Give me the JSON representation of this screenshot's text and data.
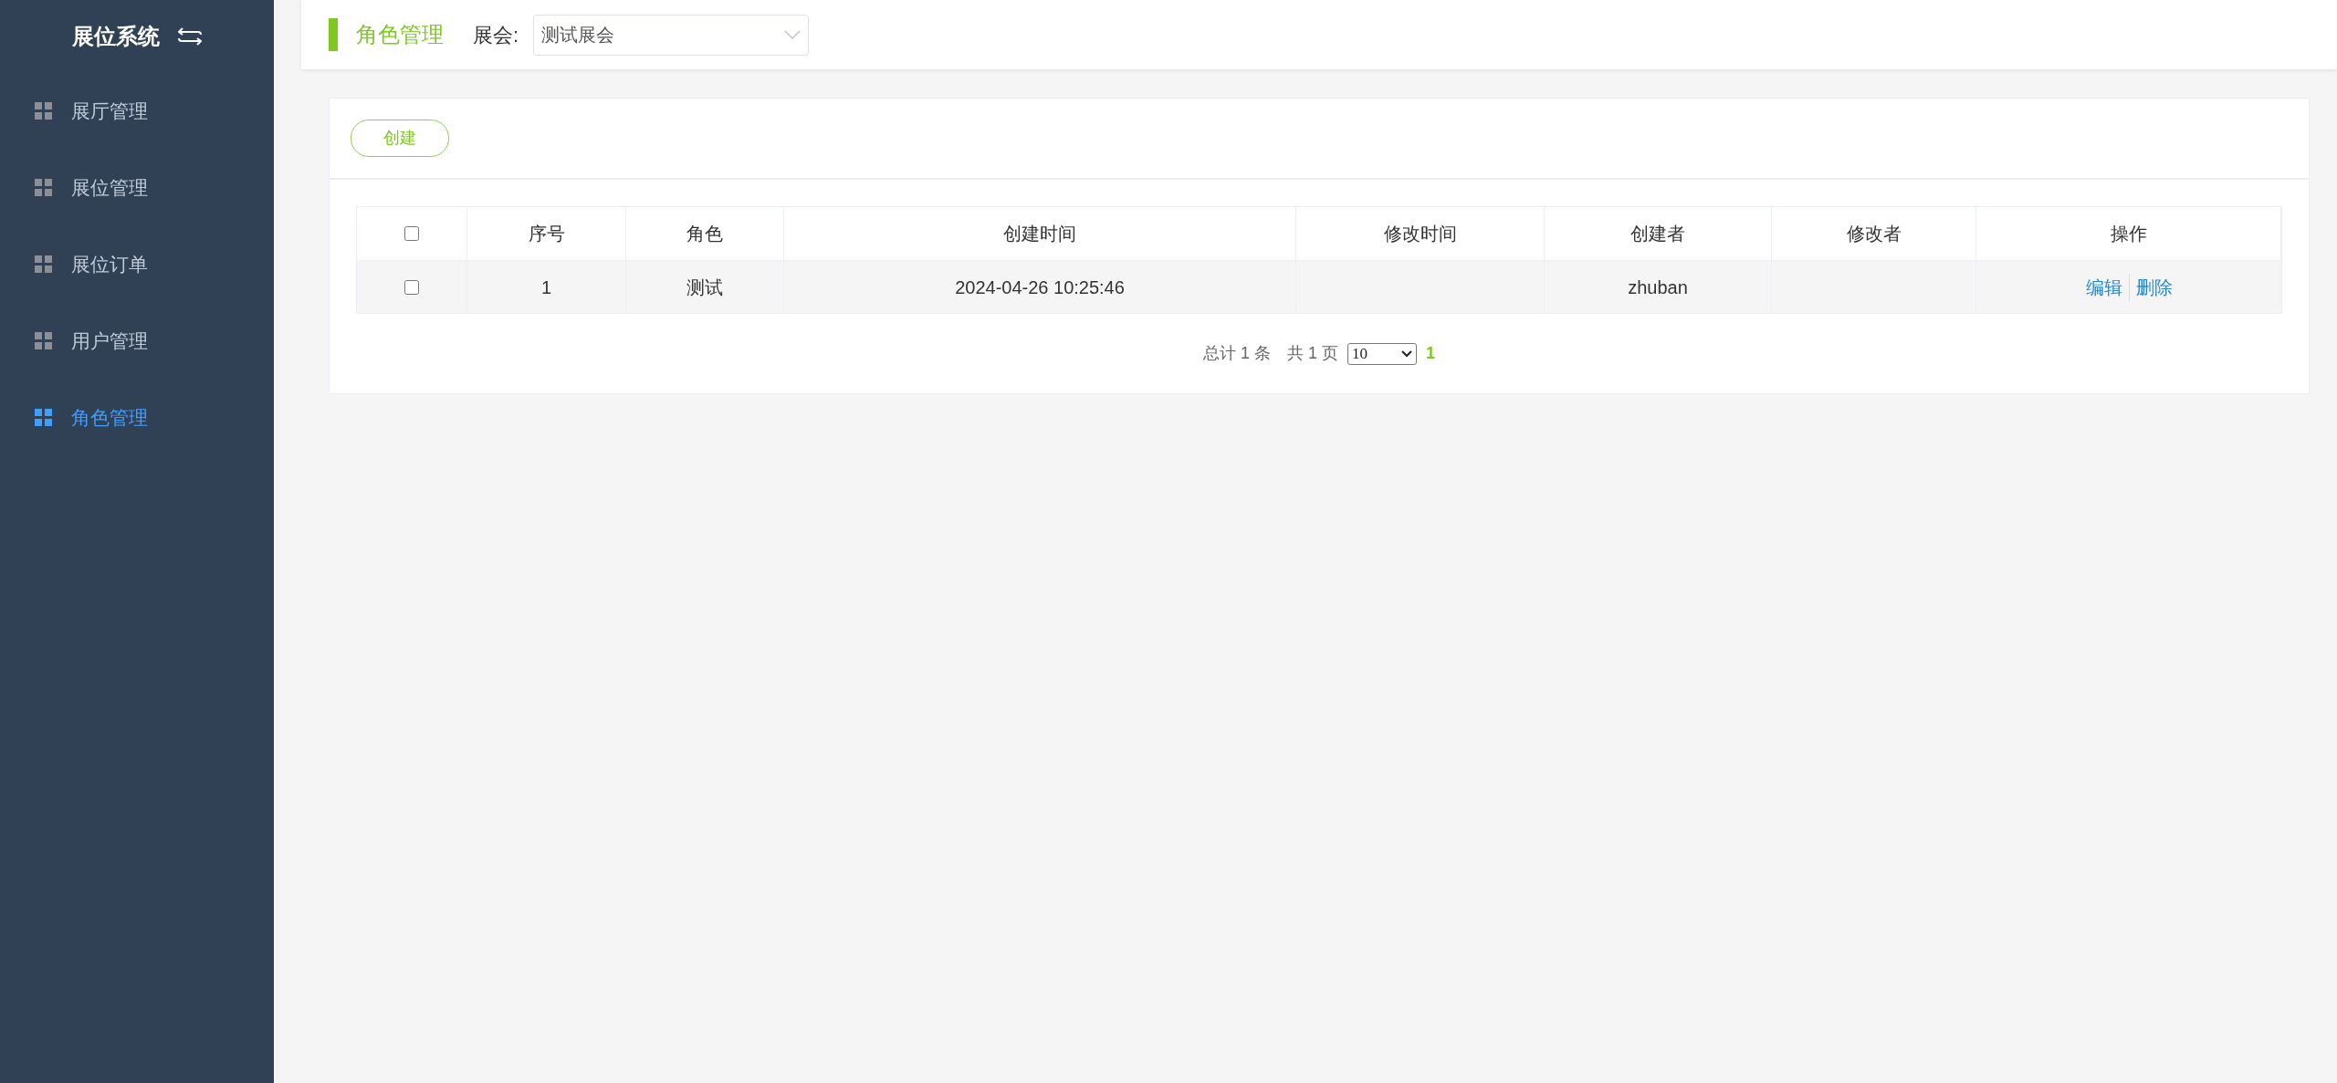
{
  "sidebar": {
    "title": "展位系统",
    "items": [
      {
        "label": "展厅管理",
        "selected": false
      },
      {
        "label": "展位管理",
        "selected": false
      },
      {
        "label": "展位订单",
        "selected": false
      },
      {
        "label": "用户管理",
        "selected": false
      },
      {
        "label": "角色管理",
        "selected": true
      }
    ]
  },
  "header": {
    "title": "角色管理",
    "field_label": "展会:",
    "select_value": "测试展会"
  },
  "toolbar": {
    "create_button": "创建"
  },
  "table": {
    "select_all_checked": false,
    "columns": [
      "序号",
      "角色",
      "创建时间",
      "修改时间",
      "创建者",
      "修改者",
      "操作"
    ],
    "rows": [
      {
        "checked": false,
        "cells": [
          "1",
          "测试",
          "2024-04-26 10:25:46",
          "",
          "zhuban",
          ""
        ],
        "actions": [
          "编辑",
          "删除"
        ]
      }
    ]
  },
  "pagination": {
    "total": "总计 1 条",
    "pages": "共 1 页",
    "page_size": "10",
    "current_page": "1"
  }
}
